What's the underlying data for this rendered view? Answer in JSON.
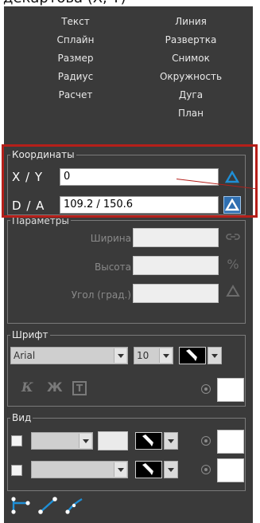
{
  "caption": "декартова (X, Y)",
  "commands": [
    {
      "label": "Текст"
    },
    {
      "label": "Линия"
    },
    {
      "label": "Сплайн"
    },
    {
      "label": "Развертка"
    },
    {
      "label": "Размер"
    },
    {
      "label": "Снимок"
    },
    {
      "label": "Радиус"
    },
    {
      "label": "Окружность"
    },
    {
      "label": "Расчет"
    },
    {
      "label": "Дуга"
    },
    {
      "label": "План"
    }
  ],
  "coordinates": {
    "title": "Координаты",
    "xy_label": "X / Y",
    "xy_value": "0",
    "da_label": "D / A",
    "da_value": "109.2 / 150.6"
  },
  "params": {
    "title": "Параметры",
    "width_label": "Ширина",
    "height_label": "Высота",
    "angle_label": "Угол (град.)",
    "percent_symbol": "%"
  },
  "font": {
    "title": "Шрифт",
    "family": "Arial",
    "size": "10",
    "italic_glyph": "К",
    "bold_glyph": "Ж",
    "box_glyph": "T"
  },
  "view": {
    "title": "Вид"
  },
  "colors": {
    "panel_bg": "#3a3a3a",
    "accent_blue": "#1f8fd6",
    "highlight_red": "#b51f1a"
  }
}
